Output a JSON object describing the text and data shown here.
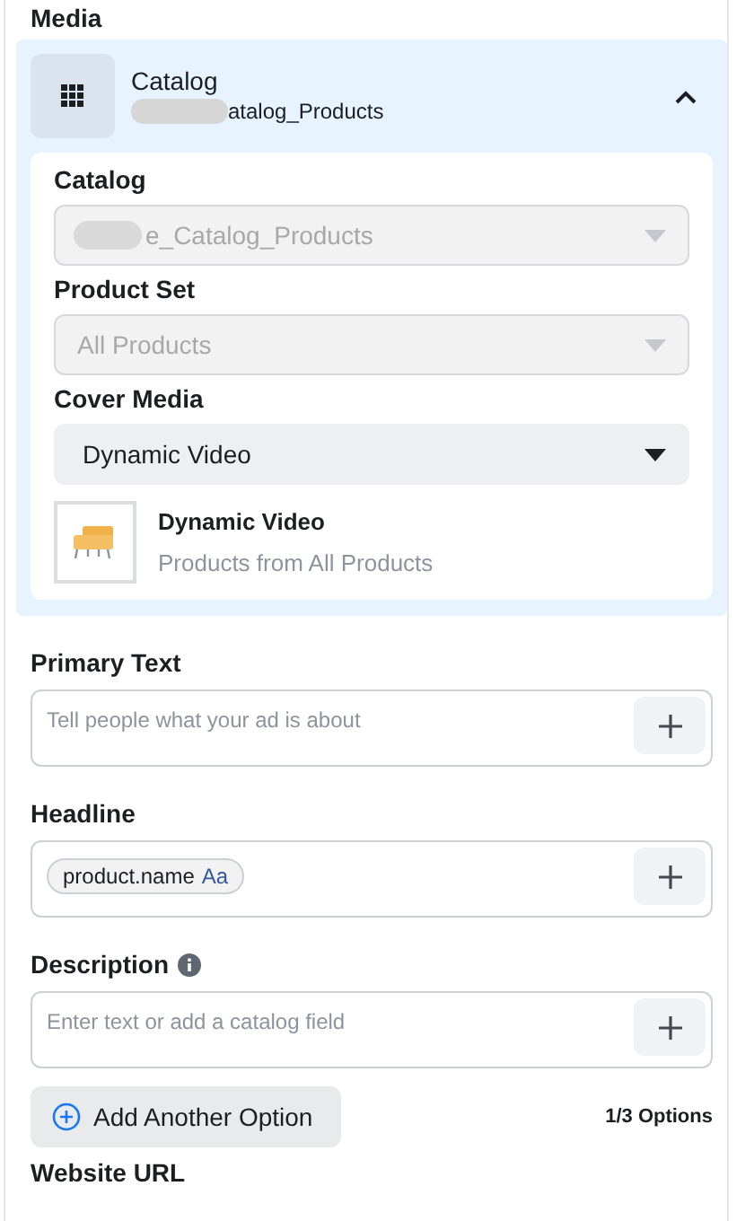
{
  "section_title": "Media",
  "media_card": {
    "title": "Catalog",
    "subtitle": "atalog_Products",
    "redacted": true,
    "expanded": true
  },
  "catalog_fields": [
    {
      "label": "Catalog",
      "value": "e_Catalog_Products",
      "disabled": true,
      "redacted": true
    },
    {
      "label": "Product Set",
      "value": "All Products",
      "disabled": true,
      "redacted": false
    },
    {
      "label": "Cover Media",
      "value": "Dynamic Video",
      "disabled": false,
      "redacted": false
    }
  ],
  "cover_preview": {
    "title": "Dynamic Video",
    "subtitle": "Products from All Products"
  },
  "text_fields": [
    {
      "kind": "text",
      "label": "Primary Text",
      "info": false,
      "placeholder": "Tell people what your ad is about"
    },
    {
      "kind": "tokens",
      "label": "Headline",
      "info": false,
      "tokens": [
        {
          "name": "product.name",
          "format": "Aa"
        }
      ]
    },
    {
      "kind": "text",
      "label": "Description",
      "info": true,
      "placeholder": "Enter text or add a catalog field"
    }
  ],
  "add_option": {
    "label": "Add Another Option",
    "count": "1/3 Options"
  },
  "next_section_title": "Website URL"
}
